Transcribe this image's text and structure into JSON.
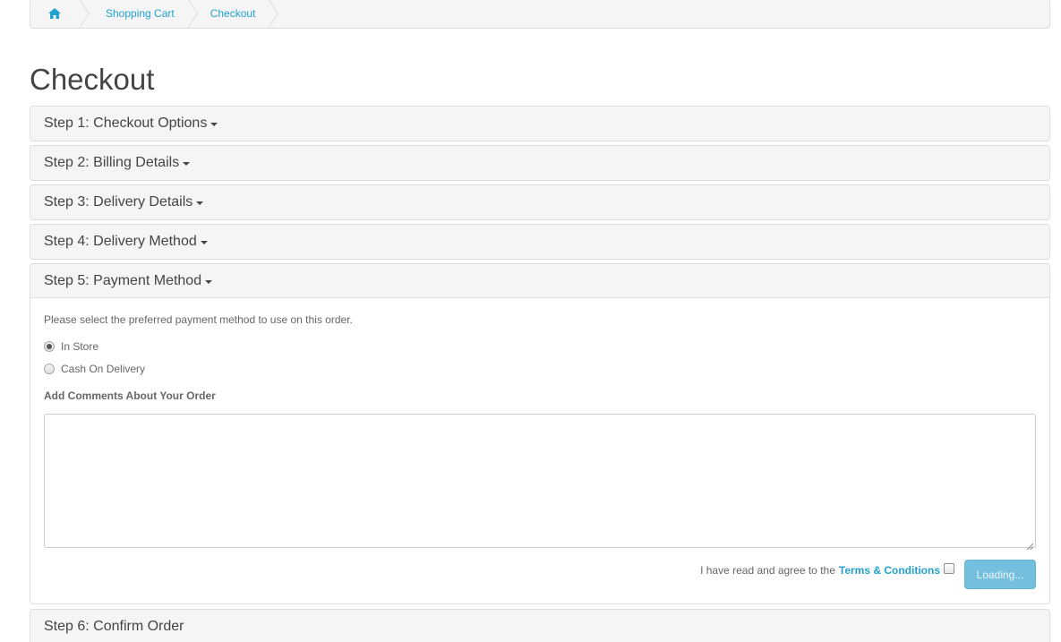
{
  "breadcrumb": {
    "home_icon": "home-icon",
    "items": [
      "Shopping Cart",
      "Checkout"
    ]
  },
  "page_title": "Checkout",
  "steps": [
    {
      "label": "Step 1: Checkout Options"
    },
    {
      "label": "Step 2: Billing Details"
    },
    {
      "label": "Step 3: Delivery Details"
    },
    {
      "label": "Step 4: Delivery Method"
    },
    {
      "label": "Step 5: Payment Method"
    },
    {
      "label": "Step 6: Confirm Order"
    }
  ],
  "payment": {
    "intro": "Please select the preferred payment method to use on this order.",
    "options": [
      {
        "label": "In Store",
        "checked": true
      },
      {
        "label": "Cash On Delivery",
        "checked": false
      }
    ],
    "comments_label": "Add Comments About Your Order",
    "comments_value": "",
    "agree_text": "I have read and agree to the",
    "terms_link": "Terms & Conditions",
    "agree_checked": false,
    "button_label": "Loading..."
  },
  "colors": {
    "link": "#23a1d1",
    "button": "#5bb4d8"
  }
}
